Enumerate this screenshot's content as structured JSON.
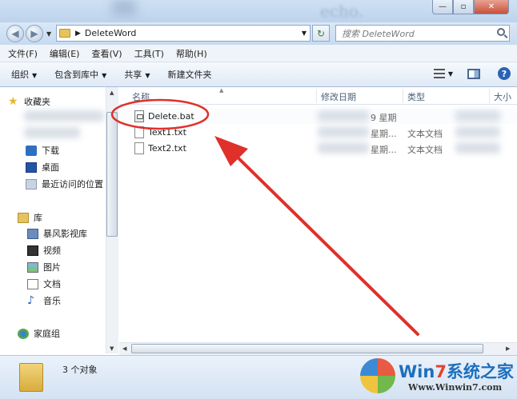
{
  "window": {
    "breadcrumb": "DeleteWord",
    "title_blur": "echo."
  },
  "search": {
    "placeholder": "搜索 DeleteWord"
  },
  "menu": [
    "文件(F)",
    "编辑(E)",
    "查看(V)",
    "工具(T)",
    "帮助(H)"
  ],
  "toolbar": {
    "organize": "组织",
    "include_library": "包含到库中",
    "share": "共享",
    "new_folder": "新建文件夹"
  },
  "nav": {
    "favorites": "收藏夹",
    "downloads": "下载",
    "desktop": "桌面",
    "recent": "最近访问的位置",
    "libraries": "库",
    "storm_video": "暴风影视库",
    "videos": "视频",
    "pictures": "图片",
    "documents": "文档",
    "music": "音乐",
    "homegroup": "家庭组"
  },
  "columns": {
    "name": "名称",
    "date": "修改日期",
    "type": "类型",
    "size": "大小"
  },
  "files": [
    {
      "name": "Delete.bat",
      "date": "9 星期",
      "type": ""
    },
    {
      "name": "Text1.txt",
      "date": "星期...",
      "type": "文本文档"
    },
    {
      "name": "Text2.txt",
      "date": "星期...",
      "type": "文本文档"
    }
  ],
  "status": {
    "count": "3 个对象"
  },
  "watermark": {
    "brand_a": "Win",
    "brand_b": "7",
    "brand_c": "系统之家",
    "url": "Www.Winwin7.com"
  },
  "colors": {
    "annotation_red": "#e0302a",
    "accent": "#1c6fbd"
  }
}
